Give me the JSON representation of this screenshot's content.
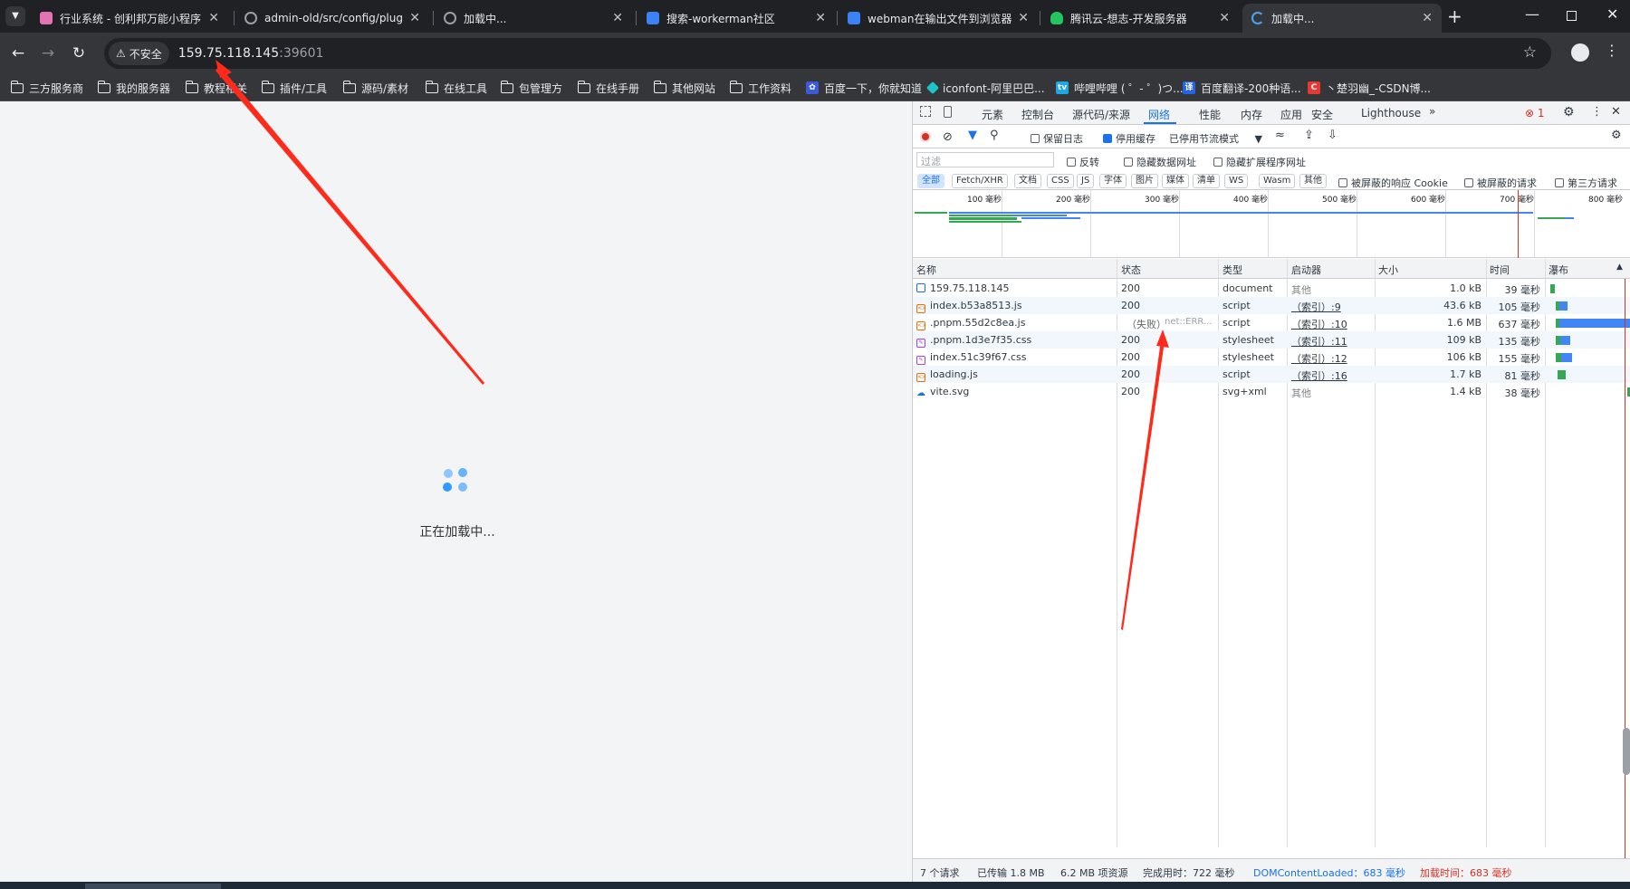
{
  "tabs": [
    {
      "title": "行业系统 - 创利邦万能小程序",
      "color": "#e573b4"
    },
    {
      "title": "admin-old/src/config/plugin...",
      "color": "#5f6368"
    },
    {
      "title": "加载中...",
      "color": "#9aa0a6"
    },
    {
      "title": "搜索-workerman社区",
      "color": "#3b82f6"
    },
    {
      "title": "webman在输出文件到浏览器时...",
      "color": "#3b82f6"
    },
    {
      "title": "腾讯云-想志-开发服务器",
      "color": "#22c55e"
    },
    {
      "title": "加载中...",
      "color": "#4aa3f7"
    }
  ],
  "address": {
    "security_label": "不安全",
    "host": "159.75.118.145",
    "port": ":39601"
  },
  "bookmarks": [
    {
      "label": "三方服务商",
      "icon": "folder-icon"
    },
    {
      "label": "我的服务器",
      "icon": "folder-icon"
    },
    {
      "label": "教程相关",
      "icon": "folder-icon"
    },
    {
      "label": "插件/工具",
      "icon": "folder-icon"
    },
    {
      "label": "源码/素材",
      "icon": "folder-icon"
    },
    {
      "label": "在线工具",
      "icon": "folder-icon"
    },
    {
      "label": "包管理方",
      "icon": "folder-icon"
    },
    {
      "label": "在线手册",
      "icon": "folder-icon"
    },
    {
      "label": "其他网站",
      "icon": "folder-icon"
    },
    {
      "label": "工作资料",
      "icon": "folder-icon"
    },
    {
      "label": "百度一下，你就知道",
      "icon": "baidu-icon"
    },
    {
      "label": "iconfont-阿里巴巴...",
      "icon": "iconfont-icon"
    },
    {
      "label": "哔哩哔哩 ( ゜- ゜)つ...",
      "icon": "bilibili-icon"
    },
    {
      "label": "百度翻译-200种语...",
      "icon": "translate-icon"
    },
    {
      "label": "丶楚羽幽_-CSDN博...",
      "icon": "csdn-icon"
    }
  ],
  "page": {
    "loading_text": "正在加载中..."
  },
  "devtools": {
    "panel_tabs": [
      "元素",
      "控制台",
      "源代码/来源",
      "网络",
      "性能",
      "内存",
      "应用",
      "安全",
      "Lighthouse"
    ],
    "active_panel": "网络",
    "error_count": "1",
    "toolbar": {
      "preserve_log": "保留日志",
      "disable_cache": "停用缓存",
      "throttle": "已停用节流模式"
    },
    "filter": {
      "placeholder": "过滤",
      "invert": "反转",
      "hide_data_urls": "隐藏数据网址",
      "hide_ext_urls": "隐藏扩展程序网址"
    },
    "type_filters": [
      "全部",
      "Fetch/XHR",
      "文档",
      "CSS",
      "JS",
      "字体",
      "图片",
      "媒体",
      "清单",
      "WS",
      "Wasm",
      "其他"
    ],
    "extra_filters": [
      "被屏蔽的响应 Cookie",
      "被屏蔽的请求",
      "第三方请求"
    ],
    "overview_ticks": [
      "100 毫秒",
      "200 毫秒",
      "300 毫秒",
      "400 毫秒",
      "500 毫秒",
      "600 毫秒",
      "700 毫秒",
      "800 毫秒"
    ],
    "columns": [
      "名称",
      "状态",
      "类型",
      "启动器",
      "大小",
      "时间",
      "瀑布"
    ],
    "requests": [
      {
        "name": "159.75.118.145",
        "status": "200",
        "type": "document",
        "initiator": "其他",
        "size": "1.0 kB",
        "time": "39 毫秒",
        "icon": "document-icon"
      },
      {
        "name": "index.b53a8513.js",
        "status": "200",
        "type": "script",
        "initiator": "（索引）:9",
        "size": "43.6 kB",
        "time": "105 毫秒",
        "icon": "script-icon"
      },
      {
        "name": ".pnpm.55d2c8ea.js",
        "status": "（失败）",
        "status_detail": "net::ERR...",
        "type": "script",
        "initiator": "（索引）:10",
        "size": "1.6 MB",
        "time": "637 毫秒",
        "icon": "script-icon"
      },
      {
        "name": ".pnpm.1d3e7f35.css",
        "status": "200",
        "type": "stylesheet",
        "initiator": "（索引）:11",
        "size": "109 kB",
        "time": "135 毫秒",
        "icon": "stylesheet-icon"
      },
      {
        "name": "index.51c39f67.css",
        "status": "200",
        "type": "stylesheet",
        "initiator": "（索引）:12",
        "size": "106 kB",
        "time": "155 毫秒",
        "icon": "stylesheet-icon"
      },
      {
        "name": "loading.js",
        "status": "200",
        "type": "script",
        "initiator": "（索引）:16",
        "size": "1.7 kB",
        "time": "81 毫秒",
        "icon": "script-icon"
      },
      {
        "name": "vite.svg",
        "status": "200",
        "type": "svg+xml",
        "initiator": "其他",
        "size": "1.4 kB",
        "time": "38 毫秒",
        "icon": "image-icon"
      }
    ],
    "status_bar": {
      "requests": "7 个请求",
      "transferred": "已传输 1.8 MB",
      "resources": "6.2 MB 项资源",
      "finish": "完成用时：722 毫秒",
      "dcl": "DOMContentLoaded：683 毫秒",
      "load": "加载时间：683 毫秒"
    }
  },
  "colors": {
    "accent": "#1a73e8",
    "error": "#d93025",
    "annotation": "#ff2a1a"
  }
}
